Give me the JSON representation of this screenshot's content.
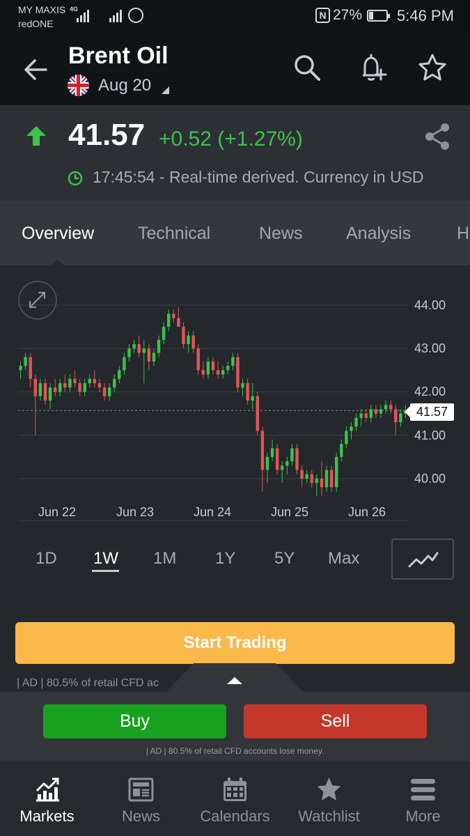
{
  "status_bar": {
    "carrier_line1": "MY MAXIS",
    "carrier_line2": "redONE",
    "network_type": "4G",
    "nfc_label": "N",
    "battery": "27%",
    "time": "5:46 PM"
  },
  "header": {
    "title": "Brent Oil",
    "expiry": "Aug 20",
    "icons": [
      "back-arrow-icon",
      "search-icon",
      "add-alert-icon",
      "star-icon"
    ]
  },
  "quote": {
    "price": "41.57",
    "change": "+0.52 (+1.27%)",
    "realtime_note": "17:45:54 - Real-time derived. Currency in USD",
    "direction": "up"
  },
  "tabs": [
    "Overview",
    "Technical",
    "News",
    "Analysis",
    "H"
  ],
  "active_tab": "Overview",
  "chart_data": {
    "type": "candlestick",
    "y_ticks": [
      "44.00",
      "43.00",
      "42.00",
      "41.00",
      "40.00"
    ],
    "ylim": [
      39.5,
      44.3
    ],
    "x_ticks": [
      "Jun 22",
      "Jun 23",
      "Jun 24",
      "Jun 25",
      "Jun 26"
    ],
    "last_price": "41.57",
    "grid": true,
    "colors": {
      "up": "#3ec14a",
      "down": "#e05757"
    },
    "candles": [
      [
        42.5,
        42.7,
        42.3,
        42.6
      ],
      [
        42.6,
        42.9,
        42.5,
        42.8
      ],
      [
        42.8,
        42.9,
        42.1,
        42.3
      ],
      [
        42.3,
        42.4,
        41.0,
        41.9
      ],
      [
        41.9,
        42.3,
        41.8,
        42.2
      ],
      [
        42.2,
        42.3,
        41.7,
        41.8
      ],
      [
        41.8,
        42.2,
        41.6,
        42.1
      ],
      [
        42.1,
        42.3,
        41.9,
        42.0
      ],
      [
        42.0,
        42.3,
        41.9,
        42.2
      ],
      [
        42.2,
        42.4,
        42.0,
        42.1
      ],
      [
        42.1,
        42.4,
        42.0,
        42.3
      ],
      [
        42.3,
        42.5,
        42.1,
        42.2
      ],
      [
        42.2,
        42.3,
        41.9,
        42.0
      ],
      [
        42.0,
        42.3,
        41.9,
        42.2
      ],
      [
        42.2,
        42.4,
        42.1,
        42.3
      ],
      [
        42.3,
        42.5,
        42.1,
        42.2
      ],
      [
        42.2,
        42.3,
        42.0,
        42.1
      ],
      [
        42.1,
        42.2,
        41.8,
        41.9
      ],
      [
        41.9,
        42.2,
        41.8,
        42.1
      ],
      [
        42.1,
        42.4,
        42.0,
        42.3
      ],
      [
        42.3,
        42.6,
        42.2,
        42.5
      ],
      [
        42.5,
        42.9,
        42.4,
        42.8
      ],
      [
        42.8,
        43.1,
        42.7,
        43.0
      ],
      [
        43.0,
        43.2,
        42.9,
        43.1
      ],
      [
        43.1,
        43.3,
        42.8,
        42.9
      ],
      [
        42.9,
        43.2,
        42.2,
        43.0
      ],
      [
        43.0,
        43.1,
        42.5,
        42.7
      ],
      [
        42.7,
        43.0,
        42.6,
        42.9
      ],
      [
        42.9,
        43.3,
        42.8,
        43.2
      ],
      [
        43.2,
        43.6,
        43.1,
        43.5
      ],
      [
        43.5,
        43.9,
        43.4,
        43.8
      ],
      [
        43.8,
        43.9,
        43.6,
        43.7
      ],
      [
        43.7,
        43.95,
        43.5,
        43.5
      ],
      [
        43.5,
        43.6,
        43.0,
        43.1
      ],
      [
        43.1,
        43.4,
        42.9,
        43.3
      ],
      [
        43.3,
        43.4,
        42.9,
        43.0
      ],
      [
        43.0,
        43.1,
        42.4,
        42.5
      ],
      [
        42.5,
        42.7,
        42.3,
        42.4
      ],
      [
        42.4,
        42.8,
        42.3,
        42.7
      ],
      [
        42.7,
        42.8,
        42.4,
        42.5
      ],
      [
        42.5,
        42.7,
        42.3,
        42.4
      ],
      [
        42.4,
        42.6,
        42.3,
        42.5
      ],
      [
        42.5,
        42.7,
        42.4,
        42.6
      ],
      [
        42.6,
        42.9,
        42.5,
        42.8
      ],
      [
        42.8,
        42.9,
        42.0,
        42.1
      ],
      [
        42.1,
        42.3,
        41.9,
        42.2
      ],
      [
        42.2,
        42.3,
        41.7,
        41.8
      ],
      [
        41.8,
        42.2,
        41.6,
        41.9
      ],
      [
        41.9,
        42.0,
        41.0,
        41.1
      ],
      [
        41.1,
        41.2,
        39.7,
        40.2
      ],
      [
        40.2,
        40.6,
        39.9,
        40.5
      ],
      [
        40.5,
        40.9,
        40.4,
        40.7
      ],
      [
        40.7,
        40.8,
        40.1,
        40.2
      ],
      [
        40.2,
        40.4,
        39.9,
        40.3
      ],
      [
        40.3,
        40.5,
        40.1,
        40.4
      ],
      [
        40.4,
        40.8,
        40.3,
        40.7
      ],
      [
        40.7,
        40.8,
        40.1,
        40.2
      ],
      [
        40.2,
        40.3,
        39.8,
        40.0
      ],
      [
        40.0,
        40.2,
        39.9,
        40.1
      ],
      [
        40.1,
        40.2,
        39.8,
        39.9
      ],
      [
        39.9,
        40.1,
        39.6,
        40.0
      ],
      [
        40.0,
        40.4,
        39.6,
        39.8
      ],
      [
        39.8,
        40.3,
        39.7,
        40.2
      ],
      [
        40.2,
        40.3,
        39.7,
        39.8
      ],
      [
        39.8,
        40.6,
        39.7,
        40.5
      ],
      [
        40.5,
        40.9,
        40.4,
        40.8
      ],
      [
        40.8,
        41.2,
        40.7,
        41.1
      ],
      [
        41.1,
        41.3,
        40.9,
        41.2
      ],
      [
        41.2,
        41.5,
        41.1,
        41.4
      ],
      [
        41.4,
        41.6,
        41.2,
        41.5
      ],
      [
        41.5,
        41.6,
        41.3,
        41.4
      ],
      [
        41.4,
        41.7,
        41.3,
        41.6
      ],
      [
        41.6,
        41.7,
        41.4,
        41.5
      ],
      [
        41.5,
        41.7,
        41.4,
        41.6
      ],
      [
        41.6,
        41.8,
        41.5,
        41.7
      ],
      [
        41.7,
        41.8,
        41.5,
        41.6
      ],
      [
        41.6,
        41.7,
        41.0,
        41.3
      ],
      [
        41.3,
        41.6,
        41.2,
        41.5
      ],
      [
        41.5,
        41.7,
        41.4,
        41.57
      ]
    ]
  },
  "ranges": [
    "1D",
    "1W",
    "1M",
    "1Y",
    "5Y",
    "Max"
  ],
  "active_range": "1W",
  "cta": {
    "label": "Start Trading",
    "color": "#fbb84b"
  },
  "ad_truncated": "| AD | 80.5% of retail CFD ac",
  "trade": {
    "buy": "Buy",
    "sell": "Sell",
    "disclaimer": "| AD | 80.5% of retail CFD accounts lose money."
  },
  "bottom_nav": [
    {
      "label": "Markets",
      "icon": "markets-chart-icon",
      "active": true
    },
    {
      "label": "News",
      "icon": "news-icon",
      "active": false
    },
    {
      "label": "Calendars",
      "icon": "calendar-icon",
      "active": false
    },
    {
      "label": "Watchlist",
      "icon": "star-icon",
      "active": false
    },
    {
      "label": "More",
      "icon": "menu-icon",
      "active": false
    }
  ]
}
